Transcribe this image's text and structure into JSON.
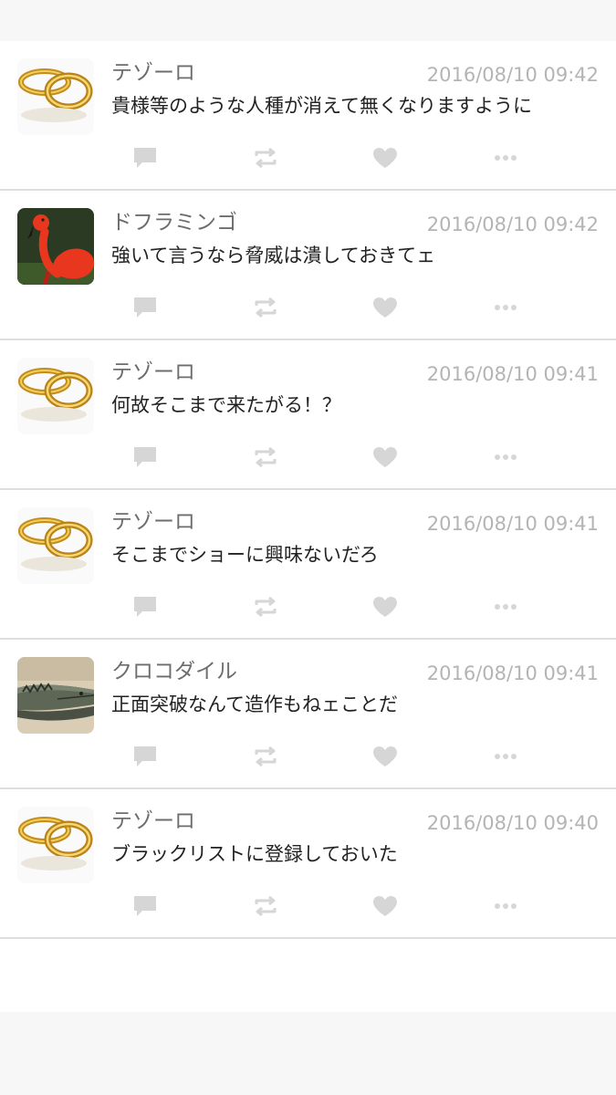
{
  "posts": [
    {
      "user": "テゾーロ",
      "time": "2016/08/10 09:42",
      "text": "貴様等のような人種が消えて無くなりますように",
      "avatar": "rings-avatar"
    },
    {
      "user": "ドフラミンゴ",
      "time": "2016/08/10 09:42",
      "text": "強いて言うなら脅威は潰しておきてェ",
      "avatar": "flamingo-avatar"
    },
    {
      "user": "テゾーロ",
      "time": "2016/08/10 09:41",
      "text": "何故そこまで来たがる！？",
      "avatar": "rings-avatar"
    },
    {
      "user": "テゾーロ",
      "time": "2016/08/10 09:41",
      "text": "そこまでショーに興味ないだろ",
      "avatar": "rings-avatar"
    },
    {
      "user": "クロコダイル",
      "time": "2016/08/10 09:41",
      "text": "正面突破なんて造作もねェことだ",
      "avatar": "crocodile-avatar"
    },
    {
      "user": "テゾーロ",
      "time": "2016/08/10 09:40",
      "text": "ブラックリストに登録しておいた",
      "avatar": "rings-avatar"
    }
  ],
  "icons": {
    "reply": "comment-icon",
    "repost": "repost-icon",
    "like": "heart-icon",
    "more": "more-dots-icon"
  },
  "colors": {
    "icon": "#d6d6d6",
    "username": "#6d6d6d",
    "timestamp": "#b4b4b4",
    "text": "#222222",
    "divider": "#dedede"
  }
}
